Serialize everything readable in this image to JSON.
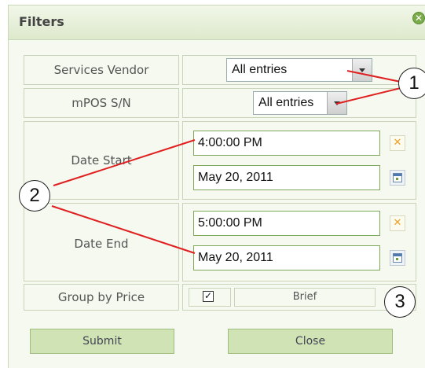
{
  "dialog": {
    "title": "Filters",
    "close_icon": "close-circle-icon"
  },
  "rows": {
    "services_vendor": {
      "label": "Services Vendor",
      "value": "All entries"
    },
    "mpos_sn": {
      "label": "mPOS S/N",
      "value": "All entries"
    },
    "date_start": {
      "label": "Date Start",
      "time": "4:00:00 PM",
      "date": "May 20, 2011"
    },
    "date_end": {
      "label": "Date End",
      "time": "5:00:00 PM",
      "date": "May 20, 2011"
    },
    "group_by_price": {
      "label": "Group by Price",
      "checked": true,
      "option": "Brief"
    }
  },
  "buttons": {
    "submit": "Submit",
    "close": "Close"
  },
  "callouts": [
    "1",
    "2",
    "3"
  ],
  "colors": {
    "annotation_line": "#e02020",
    "button_bg": "#cfe3b4",
    "panel_bg": "#f5f9ef"
  }
}
